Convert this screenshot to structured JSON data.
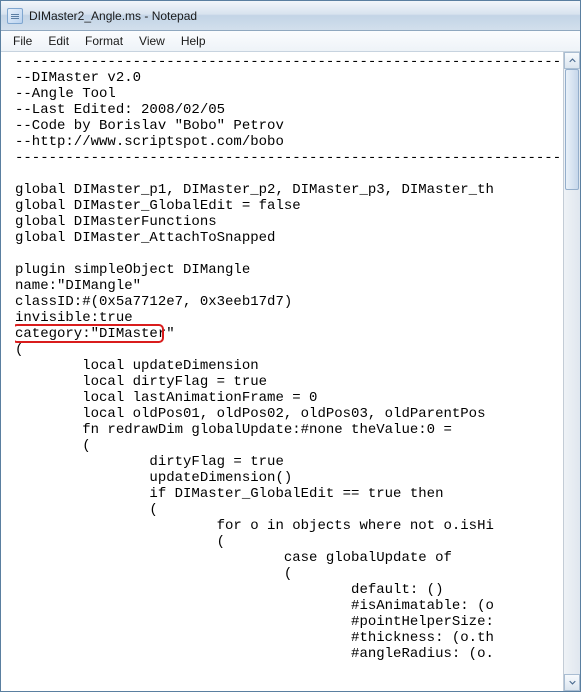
{
  "window": {
    "title": "DIMaster2_Angle.ms - Notepad"
  },
  "menubar": {
    "items": [
      "File",
      "Edit",
      "Format",
      "View",
      "Help"
    ]
  },
  "editor": {
    "lines": [
      "---------------------------------------------------------------------",
      "--DIMaster v2.0",
      "--Angle Tool",
      "--Last Edited: 2008/02/05",
      "--Code by Borislav \"Bobo\" Petrov",
      "--http://www.scriptspot.com/bobo",
      "---------------------------------------------------------------------",
      "",
      "global DIMaster_p1, DIMaster_p2, DIMaster_p3, DIMaster_th",
      "global DIMaster_GlobalEdit = false",
      "global DIMasterFunctions",
      "global DIMaster_AttachToSnapped",
      "",
      "plugin simpleObject DIMangle",
      "name:\"DIMangle\"",
      "classID:#(0x5a7712e7, 0x3eeb17d7)",
      "invisible:true",
      "category:\"DIMaster\"",
      "(",
      "        local updateDimension",
      "        local dirtyFlag = true",
      "        local lastAnimationFrame = 0",
      "        local oldPos01, oldPos02, oldPos03, oldParentPos",
      "        fn redrawDim globalUpdate:#none theValue:0 =",
      "        (",
      "                dirtyFlag = true",
      "                updateDimension()",
      "                if DIMaster_GlobalEdit == true then",
      "                (",
      "                        for o in objects where not o.isHi",
      "                        (",
      "                                case globalUpdate of",
      "                                (",
      "                                        default: ()",
      "                                        #isAnimatable: (o",
      "                                        #pointHelperSize:",
      "                                        #thickness: (o.th",
      "                                        #angleRadius: (o."
    ],
    "highlight": {
      "line_index": 17,
      "text": "category:\"DIMaster\""
    }
  },
  "scrollbar": {
    "position_pct": 0,
    "thumb_size_pct": 20
  },
  "colors": {
    "highlight_border": "#d91c1c",
    "titlebar_text": "#1a1a1a"
  }
}
